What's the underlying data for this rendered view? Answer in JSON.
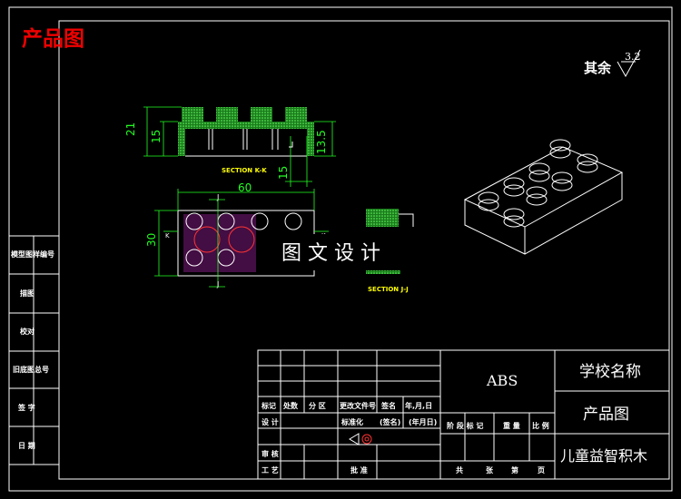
{
  "title": "产品图",
  "roughness": {
    "prefix": "其余",
    "value": "3.2"
  },
  "side_strip": [
    "模型图样编号",
    "描图",
    "校对",
    "旧底图总号",
    "签 字",
    "日 期"
  ],
  "section_kk": {
    "label": "SECTION K-K",
    "dim_21": "21",
    "dim_15": "15",
    "dim_13_5": "13.5",
    "dim_bottom_15": "15"
  },
  "top_view": {
    "dim_60": "60",
    "dim_30": "30",
    "mark_j_top": "J",
    "mark_j_bottom": "J",
    "mark_k_left": "K",
    "mark_k_right": "K"
  },
  "section_jj": {
    "label": "SECTION J-J"
  },
  "watermark": "图 文 设 计",
  "title_block": {
    "material": "ABS",
    "school": "学校名称",
    "drawing_type": "产品图",
    "part_name": "儿童益智积木",
    "row_labels": [
      "标记",
      "处数",
      "分 区",
      "更改文件号",
      "签名",
      "年,月,日"
    ],
    "design": "设 计",
    "standardize": "标准化",
    "sign": "(签名)",
    "date": "(年月日)",
    "stage_cols": [
      "阶 段 标 记",
      "重 量",
      "比 例"
    ],
    "review": "审 核",
    "process": "工 艺",
    "approve": "批 准",
    "sheets": [
      "共",
      "张",
      "第",
      "页"
    ]
  }
}
